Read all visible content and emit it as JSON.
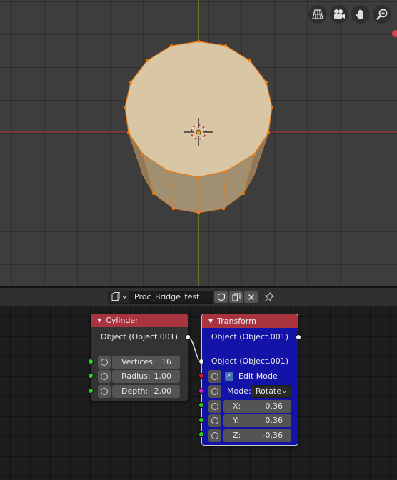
{
  "viewport": {
    "gizmo_buttons": [
      {
        "icon": "perspective-grid-icon"
      },
      {
        "icon": "camera-icon"
      },
      {
        "icon": "hand-pan-icon"
      },
      {
        "icon": "zoom-magnifier-icon"
      }
    ],
    "colors": {
      "background": "#3d3d3d",
      "mesh_face": "#d9c6a5",
      "mesh_side": "#a08a6c",
      "edge": "#e07a1a",
      "vertex": "#ff7a00",
      "x_axis": "#8b3a3a",
      "y_axis": "#6b8e23"
    }
  },
  "node_header": {
    "tree_name": "Proc_Bridge_test",
    "icons": [
      "node-tree-type-icon",
      "fake-user-shield-icon",
      "duplicate-icon",
      "unlink-x-icon",
      "pin-icon"
    ]
  },
  "nodes": {
    "cylinder": {
      "title": "Cylinder",
      "output": "Object (Object.001)",
      "fields": [
        {
          "label": "Vertices:",
          "value": "16"
        },
        {
          "label": "Radius:",
          "value": "1.00"
        },
        {
          "label": "Depth:",
          "value": "2.00"
        }
      ],
      "header_color": "#a9333f"
    },
    "transform": {
      "title": "Transform",
      "output": "Object (Object.001)",
      "input": "Object (Object.001)",
      "edit_mode_label": "Edit Mode",
      "edit_mode_checked": true,
      "mode_label": "Mode:",
      "mode_value": "Rotate",
      "fields": [
        {
          "label": "X:",
          "value": "0.36"
        },
        {
          "label": "Y:",
          "value": "0.36"
        },
        {
          "label": "Z:",
          "value": "-0.36"
        }
      ],
      "body_color": "#1313a8"
    }
  }
}
